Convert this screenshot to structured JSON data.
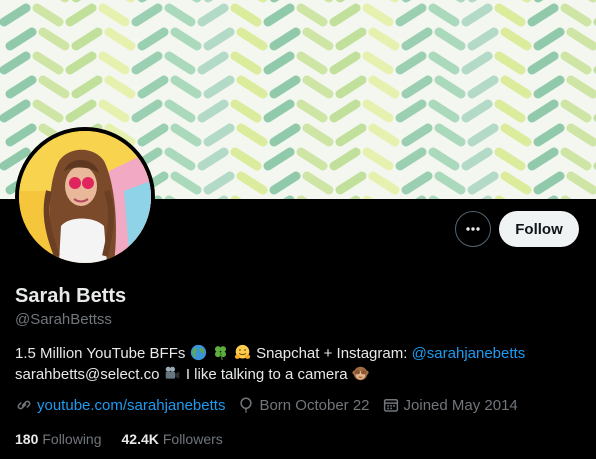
{
  "profile": {
    "display_name": "Sarah Betts",
    "handle": "@SarahBettss",
    "follow_label": "Follow",
    "bio": {
      "line1_text": "1.5 Million YouTube BFFs",
      "line1_mid": "Snapchat + Instagram:",
      "line1_mention": "@sarahjanebetts",
      "line2_text": "sarahbetts@select.co",
      "line2_tail": "I like talking to a camera",
      "emojis": [
        "globe-emoji",
        "clover-emoji",
        "hugging-face-emoji",
        "movie-camera-emoji",
        "see-no-evil-monkey-emoji"
      ]
    },
    "website": "youtube.com/sarahjanebetts",
    "birthday": "Born October 22",
    "joined": "Joined May 2014",
    "following_count": "180",
    "following_label": "Following",
    "followers_count": "42.4K",
    "followers_label": "Followers"
  },
  "icons": {
    "more": "more-horizontal-icon",
    "link": "link-icon",
    "location": "balloon-icon",
    "calendar": "calendar-icon"
  },
  "colors": {
    "background": "#000000",
    "accent": "#1d9bf0",
    "text_primary": "#e7e9ea",
    "text_secondary": "#71767b",
    "follow_bg": "#eff3f4"
  }
}
